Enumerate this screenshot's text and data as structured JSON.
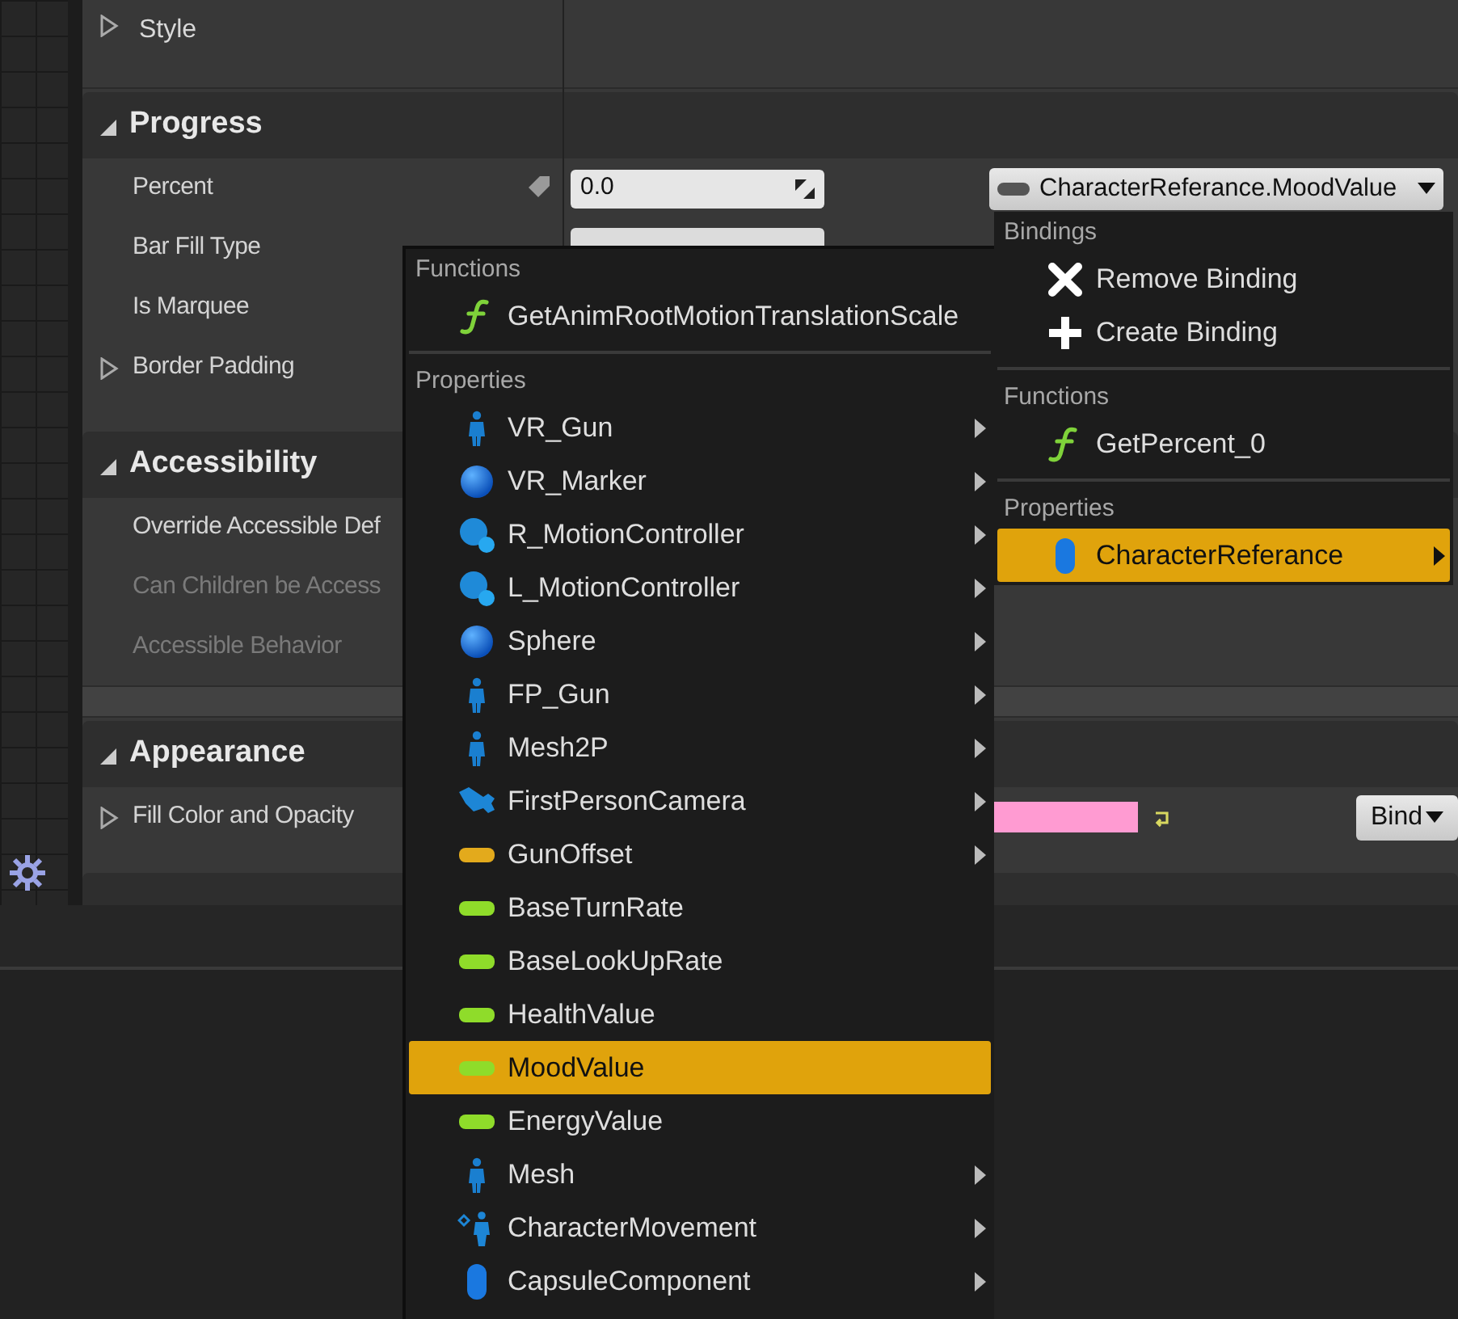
{
  "style_row": {
    "label": "Style",
    "expanded": false
  },
  "sections": [
    {
      "title": "Progress",
      "expanded": true,
      "rows": [
        {
          "label": "Percent",
          "kind": "percent",
          "expandable": false,
          "disabled": false,
          "value": "0.0",
          "binding": "CharacterReferance.MoodValue"
        },
        {
          "label": "Bar Fill Type",
          "kind": "dropdown",
          "expandable": false,
          "disabled": false
        },
        {
          "label": "Is Marquee",
          "kind": "plain",
          "expandable": false,
          "disabled": false
        },
        {
          "label": "Border Padding",
          "kind": "plain",
          "expandable": true,
          "disabled": false
        }
      ]
    },
    {
      "title": "Accessibility",
      "expanded": true,
      "rows": [
        {
          "label": "Override Accessible Def",
          "kind": "plain",
          "expandable": false,
          "disabled": false
        },
        {
          "label": "Can Children be Access",
          "kind": "plain",
          "expandable": false,
          "disabled": true
        },
        {
          "label": "Accessible Behavior",
          "kind": "plain",
          "expandable": false,
          "disabled": true
        }
      ]
    },
    {
      "title": "Appearance",
      "expanded": true,
      "rows": [
        {
          "label": "Fill Color and Opacity",
          "kind": "color",
          "expandable": true,
          "disabled": false,
          "color": "#ff9bd2",
          "bind": "Bind"
        }
      ]
    }
  ],
  "property_menu": {
    "groups": [
      {
        "heading": "Functions",
        "items": [
          {
            "label": "GetAnimRootMotionTranslationScale",
            "kind": "function",
            "selected": false,
            "has_submenu": false
          }
        ]
      },
      {
        "heading": "Properties",
        "items": [
          {
            "label": "VR_Gun",
            "kind": "person",
            "selected": false,
            "has_submenu": true
          },
          {
            "label": "VR_Marker",
            "kind": "sphere",
            "selected": false,
            "has_submenu": true
          },
          {
            "label": "R_MotionController",
            "kind": "spheres",
            "selected": false,
            "has_submenu": true
          },
          {
            "label": "L_MotionController",
            "kind": "spheres",
            "selected": false,
            "has_submenu": true
          },
          {
            "label": "Sphere",
            "kind": "sphere",
            "selected": false,
            "has_submenu": true
          },
          {
            "label": "FP_Gun",
            "kind": "person",
            "selected": false,
            "has_submenu": true
          },
          {
            "label": "Mesh2P",
            "kind": "person",
            "selected": false,
            "has_submenu": true
          },
          {
            "label": "FirstPersonCamera",
            "kind": "camera",
            "selected": false,
            "has_submenu": true
          },
          {
            "label": "GunOffset",
            "kind": "variable",
            "color": "#e3aa1c",
            "selected": false,
            "has_submenu": true
          },
          {
            "label": "BaseTurnRate",
            "kind": "variable",
            "color": "#8fdc2a",
            "selected": false,
            "has_submenu": false
          },
          {
            "label": "BaseLookUpRate",
            "kind": "variable",
            "color": "#8fdc2a",
            "selected": false,
            "has_submenu": false
          },
          {
            "label": "HealthValue",
            "kind": "variable",
            "color": "#8fdc2a",
            "selected": false,
            "has_submenu": false
          },
          {
            "label": "MoodValue",
            "kind": "variable",
            "color": "#8fdc2a",
            "selected": true,
            "has_submenu": false
          },
          {
            "label": "EnergyValue",
            "kind": "variable",
            "color": "#8fdc2a",
            "selected": false,
            "has_submenu": false
          },
          {
            "label": "Mesh",
            "kind": "person",
            "selected": false,
            "has_submenu": true
          },
          {
            "label": "CharacterMovement",
            "kind": "movement",
            "selected": false,
            "has_submenu": true
          },
          {
            "label": "CapsuleComponent",
            "kind": "capsule",
            "selected": false,
            "has_submenu": true
          }
        ]
      }
    ]
  },
  "binding_menu": {
    "groups": [
      {
        "heading": "Bindings",
        "items": [
          {
            "label": "Remove Binding",
            "kind": "remove",
            "selected": false,
            "has_submenu": false
          },
          {
            "label": "Create Binding",
            "kind": "create",
            "selected": false,
            "has_submenu": false
          }
        ]
      },
      {
        "heading": "Functions",
        "items": [
          {
            "label": "GetPercent_0",
            "kind": "function",
            "selected": false,
            "has_submenu": false
          }
        ]
      },
      {
        "heading": "Properties",
        "items": [
          {
            "label": "CharacterReferance",
            "kind": "capsule",
            "selected": true,
            "has_submenu": true
          }
        ]
      }
    ]
  }
}
